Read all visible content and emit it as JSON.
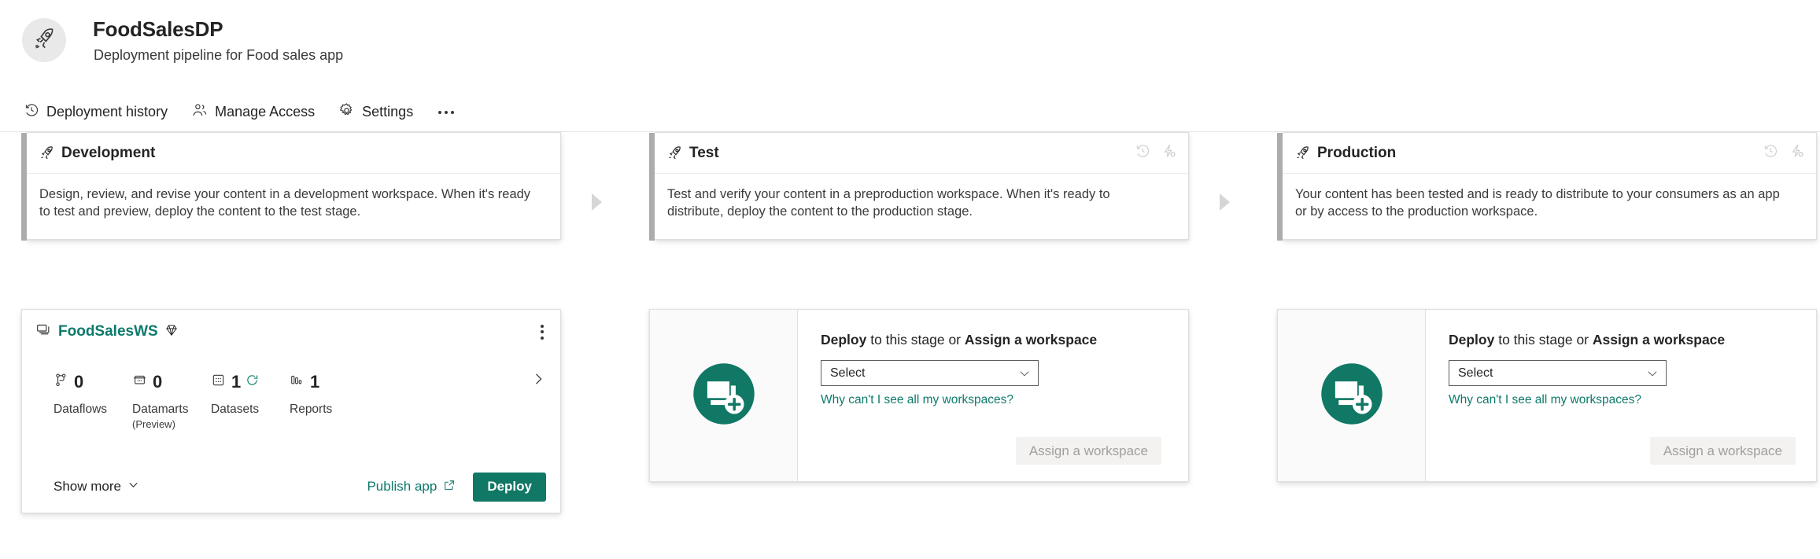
{
  "header": {
    "avatar_icon": "rocket-icon",
    "title": "FoodSalesDP",
    "subtitle": "Deployment pipeline for Food sales app"
  },
  "command_bar": {
    "items": [
      {
        "label": "Deployment history",
        "icon": "history-clock-icon"
      },
      {
        "label": "Manage Access",
        "icon": "people-icon"
      },
      {
        "label": "Settings",
        "icon": "gear-icon"
      }
    ],
    "overflow_icon": "ellipsis-icon"
  },
  "stages": [
    {
      "name": "Development",
      "icon": "rocket-icon",
      "description": "Design, review, and revise your content in a development workspace. When it's ready to test and preview, deploy the content to the test stage.",
      "actions": []
    },
    {
      "name": "Test",
      "icon": "rocket-icon",
      "description": "Test and verify your content in a preproduction workspace. When it's ready to distribute, deploy the content to the production stage.",
      "actions": [
        "history-clock-icon",
        "deployment-rules-icon"
      ]
    },
    {
      "name": "Production",
      "icon": "rocket-icon",
      "description": "Your content has been tested and is ready to distribute to your consumers as an app or by access to the production workspace.",
      "actions": [
        "history-clock-icon",
        "deployment-rules-icon"
      ]
    }
  ],
  "workspace_card": {
    "workspace_icon": "workspace-stack-icon",
    "name": "FoodSalesWS",
    "badge_icon": "premium-diamond-icon",
    "more_menu_icon": "more-vertical-icon",
    "next_icon": "chevron-right-icon",
    "metrics": [
      {
        "icon": "dataflow-icon",
        "count": "0",
        "label": "Dataflows",
        "sub": ""
      },
      {
        "icon": "datamart-icon",
        "count": "0",
        "label": "Datamarts",
        "sub": "(Preview)"
      },
      {
        "icon": "dataset-icon",
        "count": "1",
        "label": "Datasets",
        "sub": "",
        "status_icon": "refresh-icon"
      },
      {
        "icon": "report-icon",
        "count": "1",
        "label": "Reports",
        "sub": ""
      }
    ],
    "show_more_label": "Show more",
    "show_more_icon": "chevron-down-icon",
    "publish_app_label": "Publish app",
    "publish_app_icon": "external-link-icon",
    "deploy_label": "Deploy"
  },
  "empty_stage": {
    "illustration_icon": "add-workspace-illustration",
    "heading_bold_1": "Deploy",
    "heading_mid": " to this stage or ",
    "heading_bold_2": "Assign a workspace",
    "select_value": "Select",
    "select_placeholder": "Select",
    "select_chevron_icon": "chevron-down-icon",
    "help_link": "Why can't I see all my workspaces?",
    "assign_button_label": "Assign a workspace"
  },
  "colors": {
    "brand_teal": "#117865",
    "link_teal": "#0d7a6b",
    "stage_accent_gray": "#acacac",
    "arrow_gray": "#d6d6d6",
    "disabled_button_bg": "#f3f2f1",
    "disabled_button_text": "#a19f9d"
  },
  "connector_icon": "triangle-right-icon"
}
